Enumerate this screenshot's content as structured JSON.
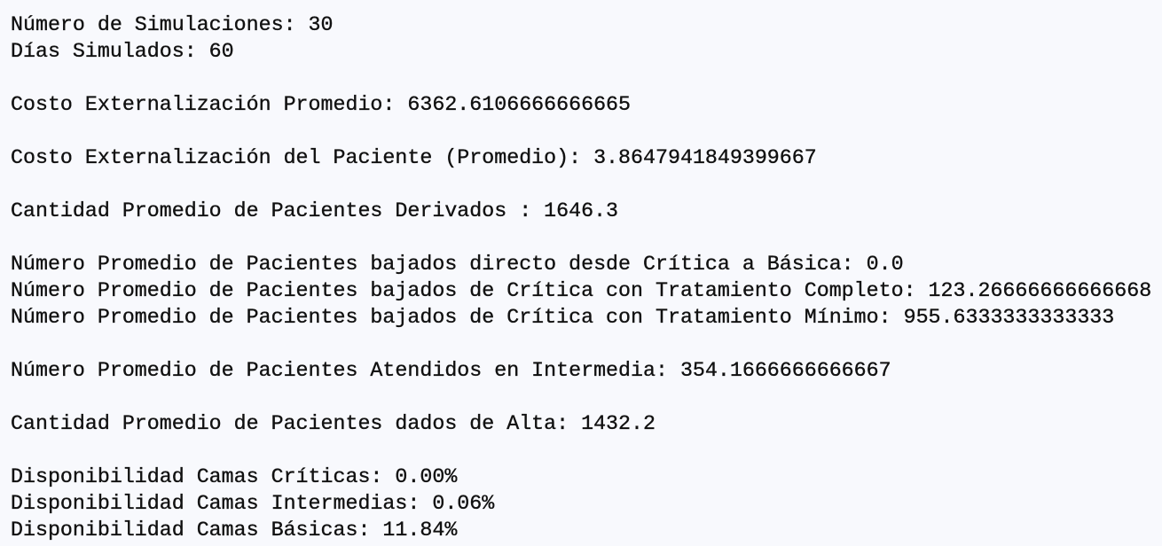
{
  "output": {
    "simulations": "Número de Simulaciones: 30",
    "days": "Días Simulados: 60",
    "avg_outsourcing_cost": "Costo Externalización Promedio: 6362.6106666666665",
    "avg_patient_outsourcing_cost": "Costo Externalización del Paciente (Promedio): 3.8647941849399667",
    "avg_referred_patients": "Cantidad Promedio de Pacientes Derivados : 1646.3",
    "lowered_direct": "Número Promedio de Pacientes bajados directo desde Crítica a Básica: 0.0",
    "lowered_complete": "Número Promedio de Pacientes bajados de Crítica con Tratamiento Completo: 123.26666666666668",
    "lowered_minimum": "Número Promedio de Pacientes bajados de Crítica con Tratamiento Mínimo: 955.6333333333333",
    "attended_intermediate": "Número Promedio de Pacientes Atendidos en Intermedia: 354.1666666666667",
    "discharged": "Cantidad Promedio de Pacientes dados de Alta: 1432.2",
    "beds_critical": "Disponibilidad Camas Críticas: 0.00%",
    "beds_intermediate": "Disponibilidad Camas Intermedias: 0.06%",
    "beds_basic": "Disponibilidad Camas Básicas: 11.84%"
  }
}
